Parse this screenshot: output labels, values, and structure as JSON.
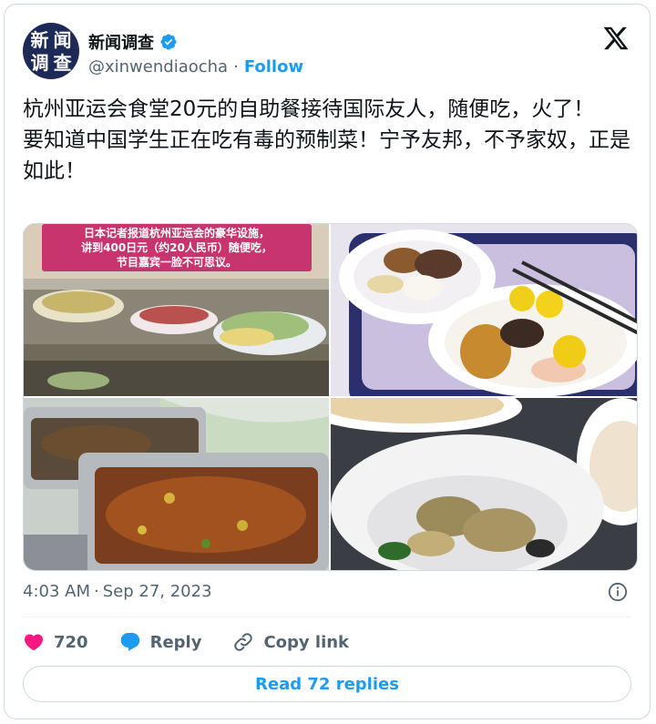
{
  "author": {
    "display_name": "新闻调查",
    "handle": "@xinwendiaocha",
    "avatar_text": [
      "新",
      "闻",
      "调",
      "查"
    ],
    "verified": true,
    "follow_label": "Follow",
    "separator": "·"
  },
  "tweet": {
    "text": "杭州亚运会食堂20元的自助餐接待国际友人，随便吃，火了！\n要知道中国学生正在吃有毒的预制菜！宁予友邦，不予家奴，正是如此！",
    "time": "4:03 AM",
    "date": "Sep 27, 2023",
    "time_separator": "·"
  },
  "media": {
    "photo1_caption": [
      "日本记者报道杭州亚运会的豪华设施，",
      "讲到400日元（约20人民币）随便吃，",
      "节目嘉宾一脸不可思议。"
    ]
  },
  "actions": {
    "like_count": "720",
    "reply_label": "Reply",
    "copy_link_label": "Copy link",
    "read_replies_label": "Read 72 replies"
  },
  "colors": {
    "accent": "#1d9bf0",
    "like": "#f91880",
    "text": "#0f1419",
    "muted": "#536471"
  },
  "icons": [
    "verified-badge-icon",
    "x-logo-icon",
    "info-icon",
    "heart-icon",
    "reply-icon",
    "link-icon"
  ]
}
